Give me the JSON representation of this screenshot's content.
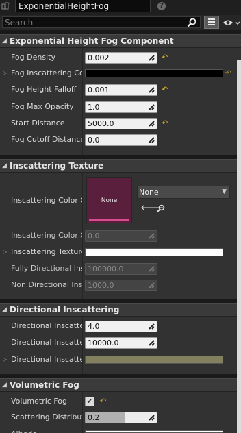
{
  "header": {
    "object_name": "ExponentialHeightFog",
    "help_glyph": "?",
    "search_placeholder": "Search"
  },
  "icons": {
    "search": "search-icon",
    "grid": "grid-view-icon",
    "eye": "eye-visibility-icon",
    "drag": "drag-handle-icon",
    "reset": "reset-to-default-icon",
    "use": "use-selected-asset-icon",
    "browse": "browse-asset-icon"
  },
  "colors": {
    "accent_reset": "#d9b42a",
    "texture_thumb": "#5a1f3d",
    "texture_bar": "#d64c8c",
    "fog_inscattering": "#000000",
    "inscattering_texture_tint": "#ffffff",
    "directional_inscattering_color": "#838060"
  },
  "sections": {
    "fog": {
      "title": "Exponential Height Fog Component",
      "props": {
        "fog_density": {
          "label": "Fog Density",
          "value": "0.002"
        },
        "fog_inscattering": {
          "label": "Fog Inscattering Colo"
        },
        "fog_height_falloff": {
          "label": "Fog Height Falloff",
          "value": "0.001"
        },
        "fog_max_opacity": {
          "label": "Fog Max Opacity",
          "value": "1.0"
        },
        "start_distance": {
          "label": "Start Distance",
          "value": "5000.0"
        },
        "fog_cutoff_distance": {
          "label": "Fog Cutoff Distance",
          "value": "0.0"
        }
      }
    },
    "texture": {
      "title": "Inscattering Texture",
      "props": {
        "cubemap": {
          "label": "Inscattering Color Cu",
          "thumb_label": "None",
          "combo_value": "None"
        },
        "cubemap_angle": {
          "label": "Inscattering Color Cu",
          "value": "0.0"
        },
        "texture_tint": {
          "label": "Inscattering Texture"
        },
        "fully_directional": {
          "label": "Fully Directional Insc",
          "value": "100000.0"
        },
        "non_directional": {
          "label": "Non Directional Insca",
          "value": "1000.0"
        }
      }
    },
    "directional": {
      "title": "Directional Inscattering",
      "props": {
        "exponent": {
          "label": "Directional Inscatteri",
          "value": "4.0"
        },
        "start_distance": {
          "label": "Directional Inscatteri",
          "value": "10000.0"
        },
        "color": {
          "label": "Directional Inscatter"
        }
      }
    },
    "volumetric": {
      "title": "Volumetric Fog",
      "props": {
        "volumetric_fog": {
          "label": "Volumetric Fog",
          "checked": true
        },
        "scattering": {
          "label": "Scattering Distributio",
          "value": "0.2",
          "fraction": 0.2
        },
        "albedo": {
          "label": "Albedo"
        }
      }
    }
  }
}
